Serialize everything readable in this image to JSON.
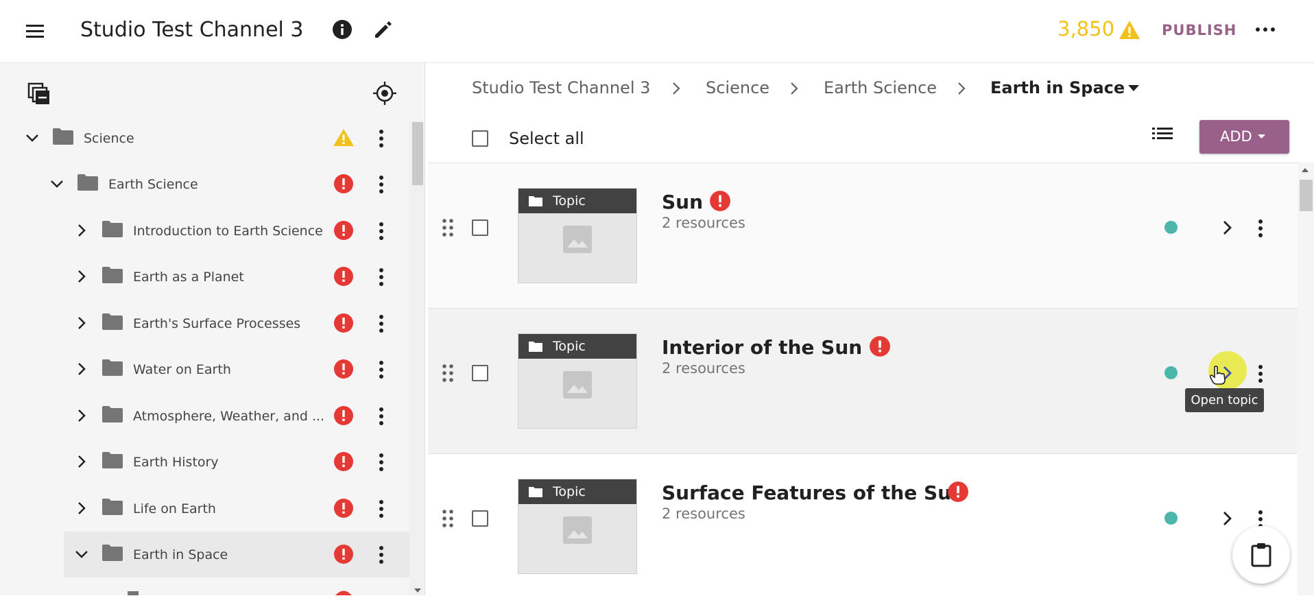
{
  "header": {
    "title": "Studio Test Channel 3",
    "count": "3,850",
    "publish_label": "PUBLISH"
  },
  "sidebar": {
    "items": [
      {
        "label": "Science",
        "status": "warning",
        "expanded": true
      },
      {
        "label": "Earth Science",
        "status": "error",
        "expanded": true
      },
      {
        "label": "Introduction to Earth Science",
        "status": "error",
        "expanded": false
      },
      {
        "label": "Earth as a Planet",
        "status": "error",
        "expanded": false
      },
      {
        "label": "Earth's Surface Processes",
        "status": "error",
        "expanded": false
      },
      {
        "label": "Water on Earth",
        "status": "error",
        "expanded": false
      },
      {
        "label": "Atmosphere, Weather, and ...",
        "status": "error",
        "expanded": false
      },
      {
        "label": "Earth History",
        "status": "error",
        "expanded": false
      },
      {
        "label": "Life on Earth",
        "status": "error",
        "expanded": false
      },
      {
        "label": "Earth in Space",
        "status": "error",
        "expanded": true,
        "selected": true
      }
    ]
  },
  "breadcrumbs": [
    "Studio Test Channel 3",
    "Science",
    "Earth Science",
    "Earth in Space"
  ],
  "toolbar": {
    "select_all": "Select all",
    "add_label": "ADD"
  },
  "topics": [
    {
      "badge": "Topic",
      "title": "Sun",
      "subtitle": "2 resources"
    },
    {
      "badge": "Topic",
      "title": "Interior of the Sun",
      "subtitle": "2 resources"
    },
    {
      "badge": "Topic",
      "title": "Surface Features of the Sun",
      "subtitle": "2 resources"
    }
  ],
  "tooltip": "Open topic",
  "colors": {
    "accent": "#996189",
    "error": "#e53935",
    "warning": "#f1c21b",
    "status_dot": "#4db6ac"
  }
}
